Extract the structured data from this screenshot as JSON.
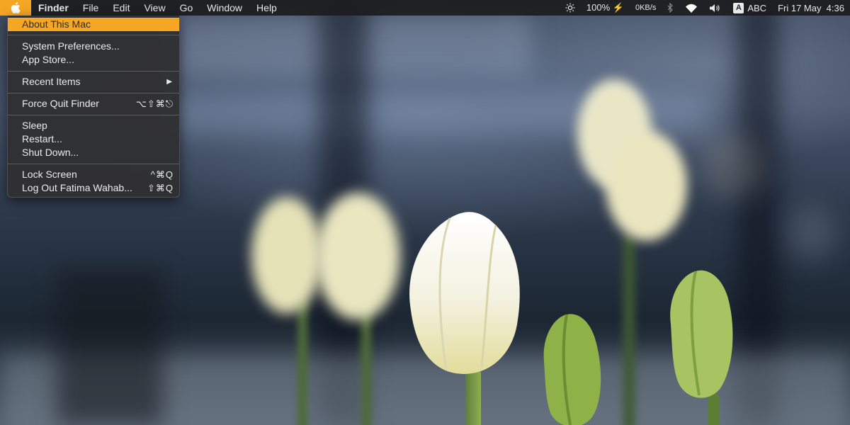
{
  "menubar": {
    "apple_icon": "apple-logo-icon",
    "items": [
      {
        "label": "Finder",
        "bold": true
      },
      {
        "label": "File"
      },
      {
        "label": "Edit"
      },
      {
        "label": "View"
      },
      {
        "label": "Go"
      },
      {
        "label": "Window"
      },
      {
        "label": "Help"
      }
    ],
    "status": {
      "brightness_icon": "brightness-icon",
      "battery": "100% ⚡",
      "network_speed": "0KB/s",
      "bluetooth_icon": "bluetooth-icon",
      "wifi_icon": "wifi-icon",
      "volume_icon": "volume-icon",
      "input_badge": "A",
      "input_source": "ABC",
      "clock": "Fri 17 May  4:36"
    }
  },
  "apple_menu": {
    "items": {
      "about": {
        "label": "About This Mac"
      },
      "prefs": {
        "label": "System Preferences..."
      },
      "store": {
        "label": "App Store..."
      },
      "recent": {
        "label": "Recent Items",
        "submenu_arrow": "▶"
      },
      "force_quit": {
        "label": "Force Quit Finder",
        "shortcut": "⌥⇧⌘⎋"
      },
      "sleep": {
        "label": "Sleep"
      },
      "restart": {
        "label": "Restart..."
      },
      "shutdown": {
        "label": "Shut Down..."
      },
      "lock": {
        "label": "Lock Screen",
        "shortcut": "^⌘Q"
      },
      "logout": {
        "label": "Log Out Fatima Wahab...",
        "shortcut": "⇧⌘Q"
      }
    }
  },
  "colors": {
    "accent": "#f5a623",
    "menu_bg": "#303032",
    "menubar_bg": "#1c1c1e"
  }
}
